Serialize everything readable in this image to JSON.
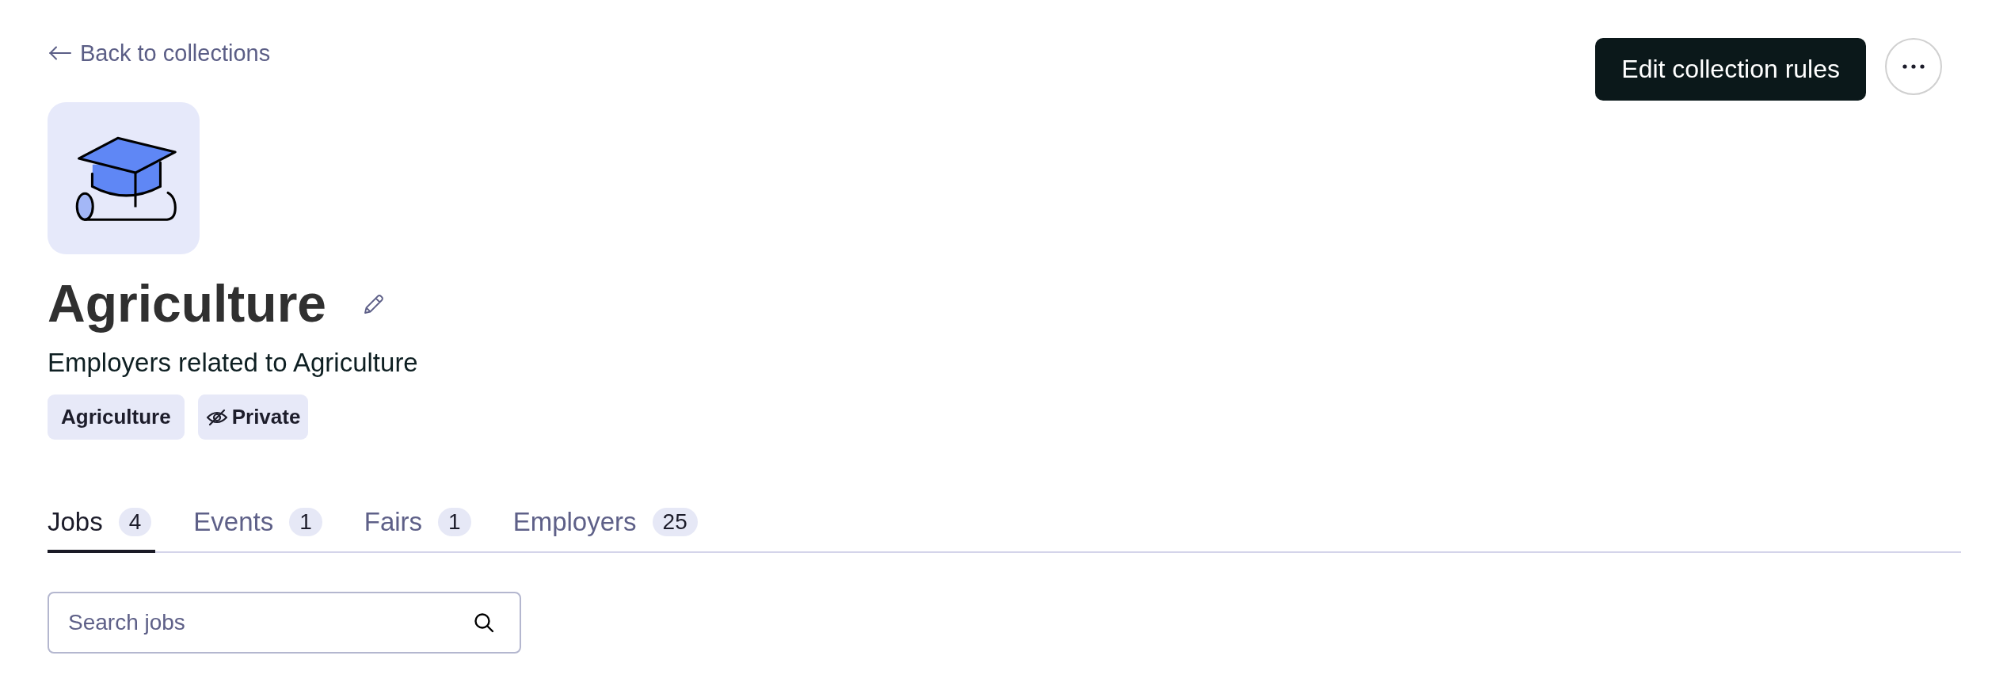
{
  "back_link": {
    "label": "Back to collections"
  },
  "actions": {
    "primary_button": "Edit collection rules"
  },
  "collection": {
    "title": "Agriculture",
    "description": "Employers related to Agriculture",
    "tags": [
      {
        "label": "Agriculture",
        "kind": "category"
      },
      {
        "label": "Private",
        "kind": "private"
      }
    ]
  },
  "tabs": [
    {
      "label": "Jobs",
      "count": "4",
      "selected": true
    },
    {
      "label": "Events",
      "count": "1",
      "selected": false
    },
    {
      "label": "Fairs",
      "count": "1",
      "selected": false
    },
    {
      "label": "Employers",
      "count": "25",
      "selected": false
    }
  ],
  "search": {
    "placeholder": "Search jobs"
  }
}
